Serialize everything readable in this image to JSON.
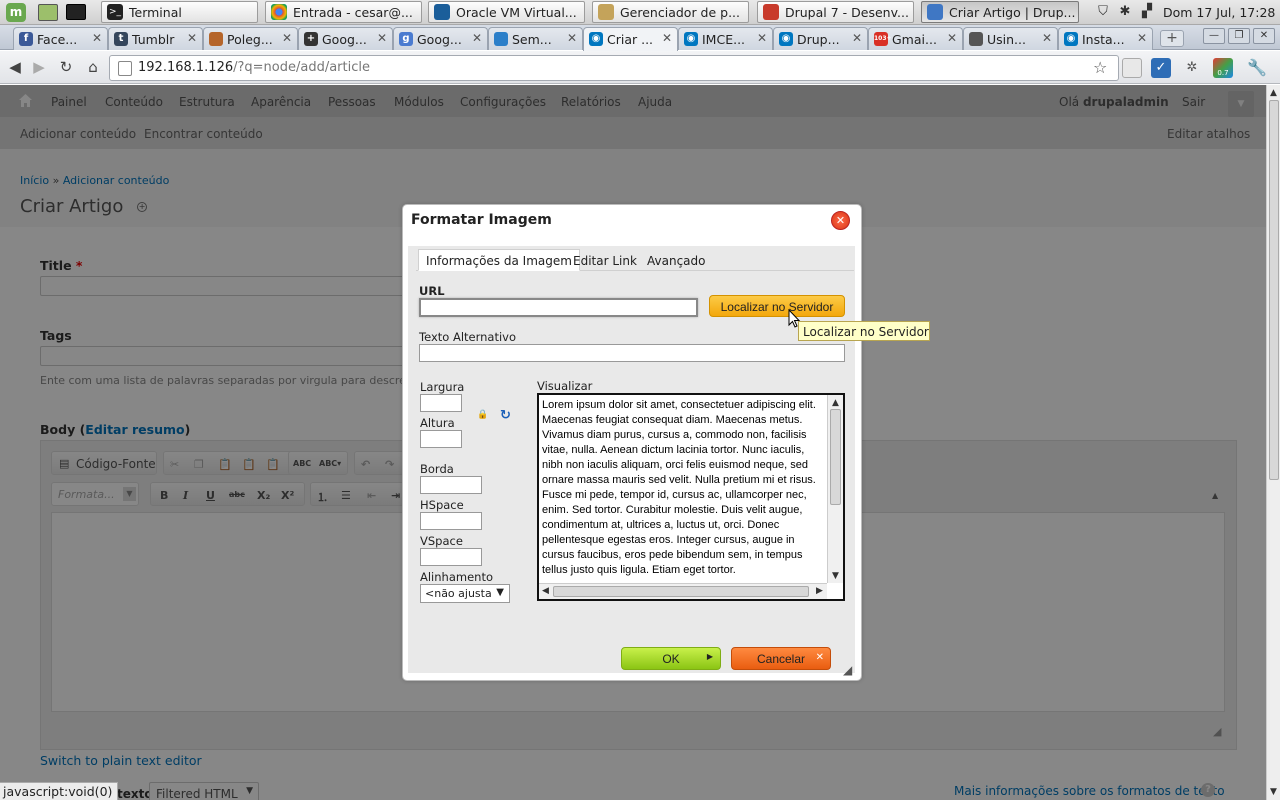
{
  "taskbar": {
    "apps": [
      {
        "label": "Terminal"
      },
      {
        "label": "Entrada - cesar@..."
      },
      {
        "label": "Oracle VM Virtual..."
      },
      {
        "label": "Gerenciador de p..."
      },
      {
        "label": "Drupal 7 - Desenv..."
      },
      {
        "label": "Criar Artigo | Drup..."
      }
    ],
    "clock": "Dom 17 Jul, 17:28"
  },
  "browser": {
    "tabs": [
      {
        "label": "Face..."
      },
      {
        "label": "Tumblr"
      },
      {
        "label": "Poleg..."
      },
      {
        "label": "Goog..."
      },
      {
        "label": "Goog..."
      },
      {
        "label": "Sem..."
      },
      {
        "label": "Criar ..."
      },
      {
        "label": "IMCE..."
      },
      {
        "label": "Drup..."
      },
      {
        "label": "Gmai..."
      },
      {
        "label": "Usin..."
      },
      {
        "label": "Insta..."
      }
    ],
    "gmail_badge": "103+",
    "ext_badge": "0.7",
    "url_host": "192.168.1.126",
    "url_path": "/?q=node/add/article"
  },
  "admin": {
    "menu": [
      "Painel",
      "Conteúdo",
      "Estrutura",
      "Aparência",
      "Pessoas",
      "Módulos",
      "Configurações",
      "Relatórios",
      "Ajuda"
    ],
    "greeting": "Olá",
    "username": "drupaladmin",
    "logout": "Sair",
    "shortcuts": [
      "Adicionar conteúdo",
      "Encontrar conteúdo"
    ],
    "edit_shortcuts": "Editar atalhos"
  },
  "page": {
    "breadcrumb_home": "Início",
    "breadcrumb_sep": "»",
    "breadcrumb_current": "Adicionar conteúdo",
    "title": "Criar Artigo",
    "title_label": "Title",
    "required_mark": "*",
    "tags_label": "Tags",
    "tags_help": "Ente com uma lista de palavras separadas por virgula para descrev",
    "body_label": "Body",
    "body_summary_link": "Editar resumo",
    "source_button": "Código-Fonte",
    "format_placeholder": "Formata...",
    "switch_editor": "Switch to plain text editor",
    "text_format_label": "texto",
    "text_format_value": "Filtered HTML",
    "more_info": "Mais informações sobre os formatos de texto",
    "status_bar": "javascript:void(0)"
  },
  "dialog": {
    "title": "Formatar Imagem",
    "tabs": [
      "Informações da Imagem",
      "Editar Link",
      "Avançado"
    ],
    "url_label": "URL",
    "url_value": "",
    "browse_button": "Localizar no Servidor",
    "tooltip": "Localizar no Servidor",
    "alt_label": "Texto Alternativo",
    "alt_value": "",
    "width_label": "Largura",
    "height_label": "Altura",
    "border_label": "Borda",
    "hspace_label": "HSpace",
    "vspace_label": "VSpace",
    "align_label": "Alinhamento",
    "align_value": "<não ajusta",
    "preview_label": "Visualizar",
    "preview_text": "Lorem ipsum dolor sit amet, consectetuer adipiscing elit. Maecenas feugiat consequat diam. Maecenas metus. Vivamus diam purus, cursus a, commodo non, facilisis vitae, nulla. Aenean dictum lacinia tortor. Nunc iaculis, nibh non iaculis aliquam, orci felis euismod neque, sed ornare massa mauris sed velit. Nulla pretium mi et risus. Fusce mi pede, tempor id, cursus ac, ullamcorper nec, enim. Sed tortor. Curabitur molestie. Duis velit augue, condimentum at, ultrices a, luctus ut, orci. Donec pellentesque egestas eros. Integer cursus, augue in cursus faucibus, eros pede bibendum sem, in tempus tellus justo quis ligula. Etiam eget tortor.",
    "ok_button": "OK",
    "cancel_button": "Cancelar"
  },
  "colors": {
    "dialog_button_orange": "#f9b417",
    "ok_green": "#a9e21e",
    "cancel_orange": "#f26a1b",
    "admin_bar": "#cbcbcb",
    "link_blue": "#0074bd"
  }
}
